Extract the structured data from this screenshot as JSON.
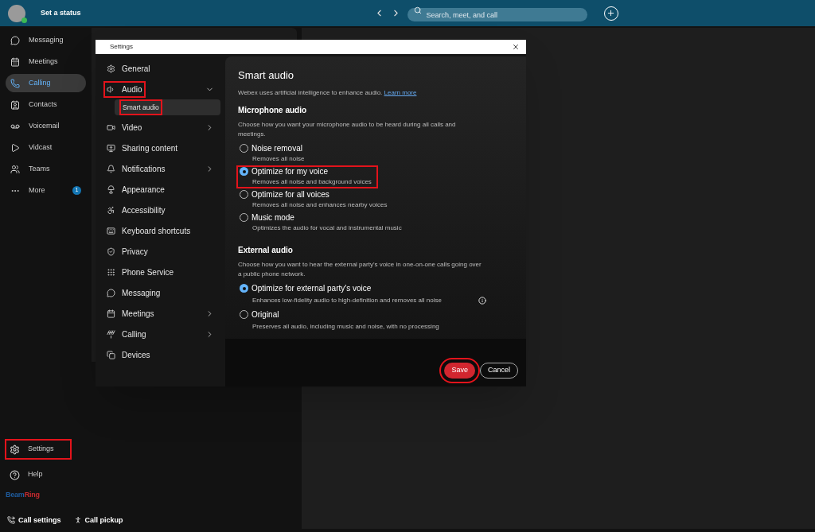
{
  "top_bar": {
    "status": "Set a status",
    "search": {
      "placeholder": "Search, meet, and call"
    }
  },
  "sidebar": {
    "items": [
      {
        "label": "Messaging",
        "selected": false
      },
      {
        "label": "Meetings",
        "selected": false
      },
      {
        "label": "Calling",
        "selected": true
      },
      {
        "label": "Contacts",
        "selected": false
      },
      {
        "label": "Voicemail",
        "selected": false
      },
      {
        "label": "Vidcast",
        "selected": false
      },
      {
        "label": "Teams",
        "selected": false
      },
      {
        "label": "More",
        "selected": false,
        "badge": "1"
      }
    ],
    "bottom_items": [
      {
        "label": "Settings",
        "highlighted": true
      },
      {
        "label": "Help",
        "highlighted": false
      }
    ],
    "brand": [
      {
        "text": "Beam",
        "color": "#1f5c9e"
      },
      {
        "text": "Ring",
        "color": "#c62a2f"
      }
    ],
    "footer": [
      "Call settings",
      "Call pickup"
    ]
  },
  "dialog": {
    "title": "Settings",
    "nav": [
      {
        "label": "General",
        "kind": "page",
        "selected": false,
        "highlighted": false
      },
      {
        "label": "Audio",
        "kind": "group",
        "expanded": true,
        "selected": false,
        "highlighted": true,
        "children": [
          {
            "label": "Smart audio",
            "selected": true,
            "highlighted": true
          }
        ]
      },
      {
        "label": "Video",
        "kind": "group",
        "expanded": false,
        "selected": false,
        "highlighted": false
      },
      {
        "label": "Sharing content",
        "kind": "page",
        "selected": false,
        "highlighted": false
      },
      {
        "label": "Notifications",
        "kind": "group",
        "expanded": false,
        "selected": false,
        "highlighted": false
      },
      {
        "label": "Appearance",
        "kind": "page",
        "selected": false,
        "highlighted": false
      },
      {
        "label": "Accessibility",
        "kind": "page",
        "selected": false,
        "highlighted": false
      },
      {
        "label": "Keyboard shortcuts",
        "kind": "page",
        "selected": false,
        "highlighted": false
      },
      {
        "label": "Privacy",
        "kind": "page",
        "selected": false,
        "highlighted": false
      },
      {
        "label": "Phone Service",
        "kind": "page",
        "selected": false,
        "highlighted": false
      },
      {
        "label": "Messaging",
        "kind": "page",
        "selected": false,
        "highlighted": false
      },
      {
        "label": "Meetings",
        "kind": "group",
        "expanded": false,
        "selected": false,
        "highlighted": false
      },
      {
        "label": "Calling",
        "kind": "group",
        "expanded": false,
        "selected": false,
        "highlighted": false
      },
      {
        "label": "Devices",
        "kind": "page",
        "selected": false,
        "highlighted": false
      }
    ],
    "heading": "Smart audio",
    "intro": "Webex uses artificial intelligence to enhance audio.",
    "intro_link": "Learn more",
    "sections": [
      {
        "title": "Microphone audio",
        "description": "Choose how you want your microphone audio to be heard during all calls and meetings.",
        "options": [
          {
            "label": "Noise removal",
            "detail": "Removes all noise",
            "selected": false,
            "highlighted": false,
            "info": false
          },
          {
            "label": "Optimize for my voice",
            "detail": "Removes all noise and background voices",
            "selected": true,
            "highlighted": true,
            "info": false
          },
          {
            "label": "Optimize for all voices",
            "detail": "Removes all noise and enhances nearby voices",
            "selected": false,
            "highlighted": false,
            "info": false
          },
          {
            "label": "Music mode",
            "detail": "Optimizes the audio for vocal and instrumental music",
            "selected": false,
            "highlighted": false,
            "info": false
          }
        ]
      },
      {
        "title": "External audio",
        "description": "Choose how you want to hear the external party's voice in one-on-one calls going over a public phone network.",
        "options": [
          {
            "label": "Optimize for external party's voice",
            "detail": "Enhances low-fidelity audio to high-definition and removes all noise",
            "selected": true,
            "highlighted": false,
            "info": true
          },
          {
            "label": "Original",
            "detail": "Preserves all audio, including music and noise, with no processing",
            "selected": false,
            "highlighted": false,
            "info": false
          }
        ]
      }
    ],
    "buttons": [
      {
        "label": "Save",
        "kind": "primary",
        "highlighted": true
      },
      {
        "label": "Cancel",
        "kind": "secondary",
        "highlighted": false
      }
    ]
  }
}
